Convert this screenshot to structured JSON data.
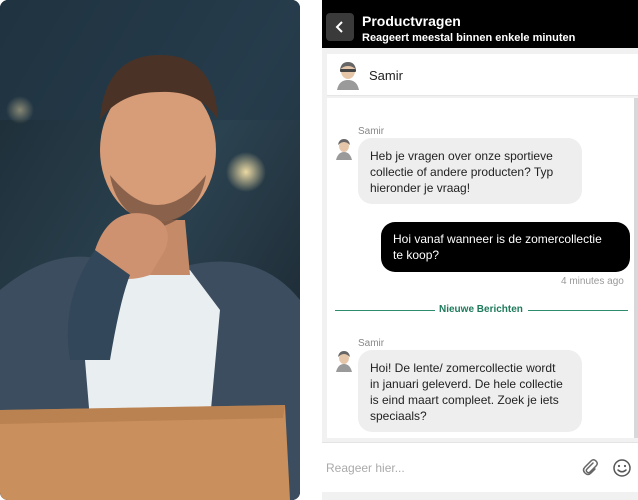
{
  "header": {
    "title": "Productvragen",
    "subtitle": "Reageert meestal binnen enkele minuten",
    "back_icon": "chevron-left-icon"
  },
  "agent": {
    "name": "Samir",
    "avatar_icon": "agent-avatar-icon"
  },
  "messages": [
    {
      "direction": "incoming",
      "sender": "Samir",
      "lines": [
        "Heb je vragen over onze sportieve",
        "collectie of andere producten? Typ",
        "hieronder je vraag!"
      ]
    },
    {
      "direction": "outgoing",
      "lines": [
        "Hoi vanaf wanneer is de zomercollectie",
        "te koop?"
      ],
      "time": "4 minutes ago"
    },
    {
      "direction": "incoming",
      "sender": "Samir",
      "lines": [
        "Hoi! De lente/ zomercollectie wordt",
        "in januari geleverd. De hele collectie",
        "is eind maart compleet. Zoek je iets",
        "speciaals?"
      ]
    }
  ],
  "divider": {
    "label": "Nieuwe Berichten"
  },
  "composer": {
    "placeholder": "Reageer hier...",
    "attach_icon": "paperclip-icon",
    "emoji_icon": "smiley-icon"
  },
  "colors": {
    "header_bg": "#000000",
    "outgoing_bubble": "#000000",
    "incoming_bubble": "#eeeeee",
    "divider_accent": "#2e8b6b"
  }
}
